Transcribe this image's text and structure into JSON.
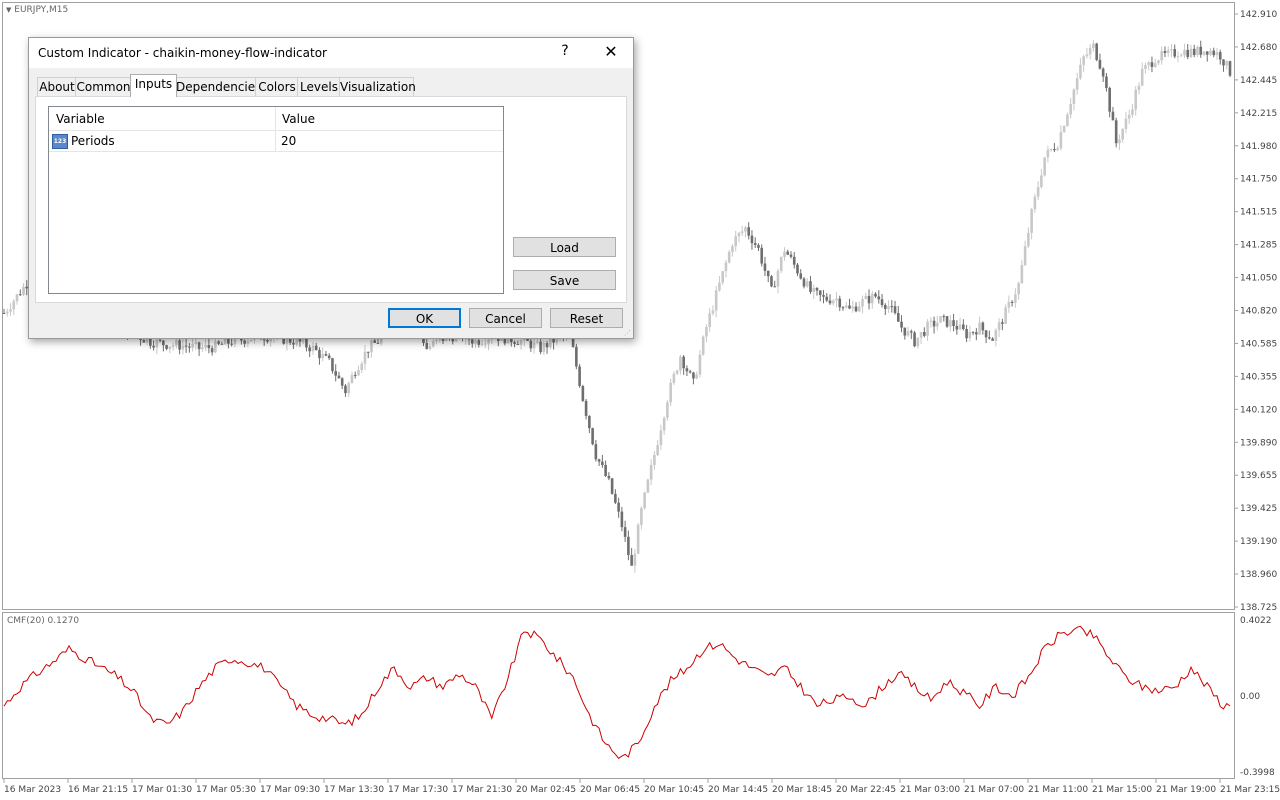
{
  "chart": {
    "symbol_label": "EURJPY,M15",
    "price_labels": [
      "142.910",
      "142.680",
      "142.445",
      "142.215",
      "141.980",
      "141.750",
      "141.515",
      "141.285",
      "141.050",
      "140.820",
      "140.585",
      "140.355",
      "140.120",
      "139.890",
      "139.655",
      "139.425",
      "139.190",
      "138.960",
      "138.725"
    ],
    "indicator_label": "CMF(20) 0.1270",
    "indicator_labels": [
      "0.4022",
      "0.00",
      "-0.3998"
    ],
    "time_labels": [
      "16 Mar 2023",
      "16 Mar 21:15",
      "17 Mar 01:30",
      "17 Mar 05:30",
      "17 Mar 09:30",
      "17 Mar 13:30",
      "17 Mar 17:30",
      "17 Mar 21:30",
      "20 Mar 02:45",
      "20 Mar 06:45",
      "20 Mar 10:45",
      "20 Mar 14:45",
      "20 Mar 18:45",
      "20 Mar 22:45",
      "21 Mar 03:00",
      "21 Mar 07:00",
      "21 Mar 11:00",
      "21 Mar 15:00",
      "21 Mar 19:00",
      "21 Mar 23:15"
    ],
    "colors": {
      "bull_candle": "#c8c8c8",
      "bear_candle": "#6e6e6e",
      "indicator_line": "#cc0000",
      "grid_frame": "#a0a0a0"
    }
  },
  "chart_data": [
    {
      "type": "candlestick",
      "title": "EURJPY,M15",
      "ylim": [
        138.725,
        142.91
      ],
      "close_path": [
        [
          0,
          140.8
        ],
        [
          10,
          141.1
        ],
        [
          20,
          141.25
        ],
        [
          25,
          141.2
        ],
        [
          30,
          140.9
        ],
        [
          35,
          140.7
        ],
        [
          40,
          140.65
        ],
        [
          45,
          140.6
        ],
        [
          50,
          140.58
        ],
        [
          55,
          140.57
        ],
        [
          60,
          140.55
        ],
        [
          65,
          140.56
        ],
        [
          70,
          140.6
        ],
        [
          75,
          140.62
        ],
        [
          80,
          140.64
        ],
        [
          85,
          140.62
        ],
        [
          90,
          140.6
        ],
        [
          95,
          140.55
        ],
        [
          100,
          140.45
        ],
        [
          105,
          140.25
        ],
        [
          108,
          140.4
        ],
        [
          112,
          140.55
        ],
        [
          115,
          140.6
        ],
        [
          118,
          140.75
        ],
        [
          122,
          140.8
        ],
        [
          126,
          140.78
        ],
        [
          130,
          140.55
        ],
        [
          135,
          140.62
        ],
        [
          140,
          140.65
        ],
        [
          145,
          140.6
        ],
        [
          150,
          140.64
        ],
        [
          155,
          140.62
        ],
        [
          160,
          140.6
        ],
        [
          165,
          140.55
        ],
        [
          170,
          140.62
        ],
        [
          174,
          140.65
        ],
        [
          178,
          140.2
        ],
        [
          182,
          139.8
        ],
        [
          186,
          139.6
        ],
        [
          190,
          139.3
        ],
        [
          193,
          139.0
        ],
        [
          196,
          139.4
        ],
        [
          200,
          139.8
        ],
        [
          204,
          140.2
        ],
        [
          208,
          140.5
        ],
        [
          212,
          140.3
        ],
        [
          216,
          140.7
        ],
        [
          220,
          141.0
        ],
        [
          224,
          141.3
        ],
        [
          228,
          141.4
        ],
        [
          232,
          141.25
        ],
        [
          236,
          140.95
        ],
        [
          240,
          141.25
        ],
        [
          244,
          141.1
        ],
        [
          248,
          140.95
        ],
        [
          252,
          140.9
        ],
        [
          256,
          140.9
        ],
        [
          260,
          140.82
        ],
        [
          264,
          140.88
        ],
        [
          268,
          140.92
        ],
        [
          272,
          140.85
        ],
        [
          276,
          140.7
        ],
        [
          280,
          140.6
        ],
        [
          284,
          140.7
        ],
        [
          288,
          140.75
        ],
        [
          292,
          140.72
        ],
        [
          296,
          140.65
        ],
        [
          300,
          140.7
        ],
        [
          304,
          140.62
        ],
        [
          308,
          140.8
        ],
        [
          312,
          141.0
        ],
        [
          316,
          141.5
        ],
        [
          320,
          141.9
        ],
        [
          324,
          142.0
        ],
        [
          328,
          142.3
        ],
        [
          332,
          142.6
        ],
        [
          335,
          142.68
        ],
        [
          338,
          142.5
        ],
        [
          342,
          142.0
        ],
        [
          346,
          142.2
        ],
        [
          350,
          142.5
        ],
        [
          354,
          142.6
        ],
        [
          358,
          142.62
        ],
        [
          362,
          142.65
        ],
        [
          366,
          142.64
        ],
        [
          370,
          142.66
        ],
        [
          374,
          142.62
        ],
        [
          377,
          142.5
        ]
      ]
    },
    {
      "type": "line",
      "title": "CMF(20) 0.1270",
      "ylim": [
        -0.3998,
        0.4022
      ],
      "series": [
        {
          "values": [
            [
              0,
              -0.05
            ],
            [
              5,
              0.05
            ],
            [
              10,
              0.12
            ],
            [
              15,
              0.18
            ],
            [
              20,
              0.25
            ],
            [
              25,
              0.2
            ],
            [
              30,
              0.15
            ],
            [
              35,
              0.1
            ],
            [
              40,
              0.02
            ],
            [
              45,
              -0.12
            ],
            [
              50,
              -0.15
            ],
            [
              55,
              -0.08
            ],
            [
              60,
              0.05
            ],
            [
              65,
              0.15
            ],
            [
              70,
              0.2
            ],
            [
              75,
              0.18
            ],
            [
              80,
              0.15
            ],
            [
              85,
              0.05
            ],
            [
              90,
              -0.05
            ],
            [
              95,
              -0.1
            ],
            [
              100,
              -0.12
            ],
            [
              105,
              -0.15
            ],
            [
              110,
              -0.1
            ],
            [
              115,
              0.05
            ],
            [
              120,
              0.15
            ],
            [
              125,
              0.05
            ],
            [
              130,
              0.1
            ],
            [
              135,
              0.05
            ],
            [
              140,
              0.12
            ],
            [
              145,
              0.05
            ],
            [
              150,
              -0.12
            ],
            [
              155,
              0.1
            ],
            [
              160,
              0.35
            ],
            [
              165,
              0.3
            ],
            [
              170,
              0.2
            ],
            [
              175,
              0.1
            ],
            [
              180,
              -0.1
            ],
            [
              185,
              -0.25
            ],
            [
              190,
              -0.33
            ],
            [
              195,
              -0.25
            ],
            [
              200,
              -0.05
            ],
            [
              205,
              0.08
            ],
            [
              210,
              0.15
            ],
            [
              215,
              0.25
            ],
            [
              220,
              0.28
            ],
            [
              225,
              0.2
            ],
            [
              230,
              0.15
            ],
            [
              235,
              0.1
            ],
            [
              240,
              0.15
            ],
            [
              245,
              0.05
            ],
            [
              250,
              -0.05
            ],
            [
              255,
              -0.02
            ],
            [
              260,
              0.0
            ],
            [
              265,
              -0.05
            ],
            [
              270,
              0.05
            ],
            [
              275,
              0.12
            ],
            [
              280,
              0.05
            ],
            [
              285,
              -0.02
            ],
            [
              290,
              0.08
            ],
            [
              295,
              0.02
            ],
            [
              300,
              -0.05
            ],
            [
              305,
              0.05
            ],
            [
              310,
              0.0
            ],
            [
              315,
              0.1
            ],
            [
              320,
              0.25
            ],
            [
              325,
              0.33
            ],
            [
              330,
              0.35
            ],
            [
              335,
              0.32
            ],
            [
              340,
              0.2
            ],
            [
              345,
              0.1
            ],
            [
              350,
              0.05
            ],
            [
              355,
              0.03
            ],
            [
              360,
              0.05
            ],
            [
              365,
              0.15
            ],
            [
              370,
              0.05
            ],
            [
              375,
              -0.05
            ]
          ]
        }
      ]
    }
  ],
  "dialog": {
    "title": "Custom Indicator - chaikin-money-flow-indicator",
    "help_label": "?",
    "close_label": "✕",
    "tabs": [
      {
        "label": "About"
      },
      {
        "label": "Common"
      },
      {
        "label": "Inputs"
      },
      {
        "label": "Dependencies"
      },
      {
        "label": "Colors"
      },
      {
        "label": "Levels"
      },
      {
        "label": "Visualization"
      }
    ],
    "active_tab": "Inputs",
    "grid": {
      "col_variable": "Variable",
      "col_value": "Value",
      "rows": [
        {
          "icon": "123",
          "variable": "Periods",
          "value": "20"
        }
      ]
    },
    "load_label": "Load",
    "save_label": "Save",
    "ok_label": "OK",
    "cancel_label": "Cancel",
    "reset_label": "Reset"
  }
}
